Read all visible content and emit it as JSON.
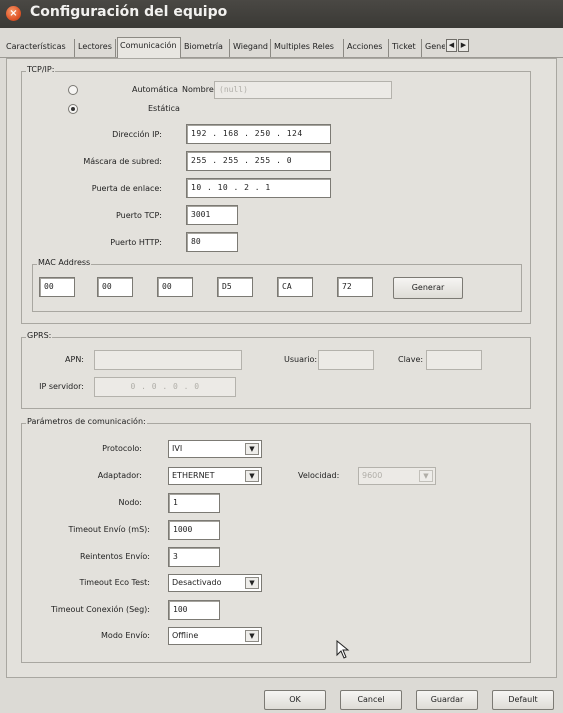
{
  "window": {
    "title": "Configuración del equipo"
  },
  "tabs": [
    {
      "label": "Características",
      "active": false
    },
    {
      "label": "Lectores",
      "active": false
    },
    {
      "label": "Comunicación",
      "active": true
    },
    {
      "label": "Biometría",
      "active": false
    },
    {
      "label": "Wiegand",
      "active": false
    },
    {
      "label": "Multiples Reles",
      "active": false
    },
    {
      "label": "Acciones",
      "active": false
    },
    {
      "label": "Ticket",
      "active": false
    },
    {
      "label": "Genera",
      "active": false
    }
  ],
  "tcpip": {
    "legend": "TCP/IP:",
    "mode_auto_label": "Automática",
    "mode_static_label": "Estática",
    "selected_mode": "Estática",
    "nombre_label": "Nombre:",
    "nombre_value": "(null)",
    "ip_label": "Dirección IP:",
    "ip_value": "192 . 168 . 250 . 124",
    "mask_label": "Máscara de subred:",
    "mask_value": "255 . 255 . 255 . 0",
    "gateway_label": "Puerta de enlace:",
    "gateway_value": "10 . 10 . 2 . 1",
    "tcp_port_label": "Puerto TCP:",
    "tcp_port_value": "3001",
    "http_port_label": "Puerto HTTP:",
    "http_port_value": "80",
    "mac": {
      "legend": "MAC Address",
      "octets": [
        "00",
        "00",
        "00",
        "D5",
        "CA",
        "72"
      ],
      "generate_label": "Generar"
    }
  },
  "gprs": {
    "legend": "GPRS:",
    "apn_label": "APN:",
    "apn_value": "",
    "user_label": "Usuario:",
    "user_value": "",
    "key_label": "Clave:",
    "key_value": "",
    "server_label": "IP servidor:",
    "server_value": "0 . 0 . 0 . 0"
  },
  "params": {
    "legend": "Parámetros de comunicación:",
    "protocol_label": "Protocolo:",
    "protocol_value": "IVI",
    "adapter_label": "Adaptador:",
    "adapter_value": "ETHERNET",
    "speed_label": "Velocidad:",
    "speed_value": "9600",
    "node_label": "Nodo:",
    "node_value": "1",
    "timeout_send_label": "Timeout Envío (mS):",
    "timeout_send_value": "1000",
    "retries_label": "Reintentos Envío:",
    "retries_value": "3",
    "echo_label": "Timeout Eco Test:",
    "echo_value": "Desactivado",
    "conn_timeout_label": "Timeout Conexión (Seg):",
    "conn_timeout_value": "100",
    "send_mode_label": "Modo Envío:",
    "send_mode_value": "Offline"
  },
  "footer": {
    "ok_label": "OK",
    "cancel_label": "Cancel",
    "save_label": "Guardar",
    "default_label": "Default"
  }
}
